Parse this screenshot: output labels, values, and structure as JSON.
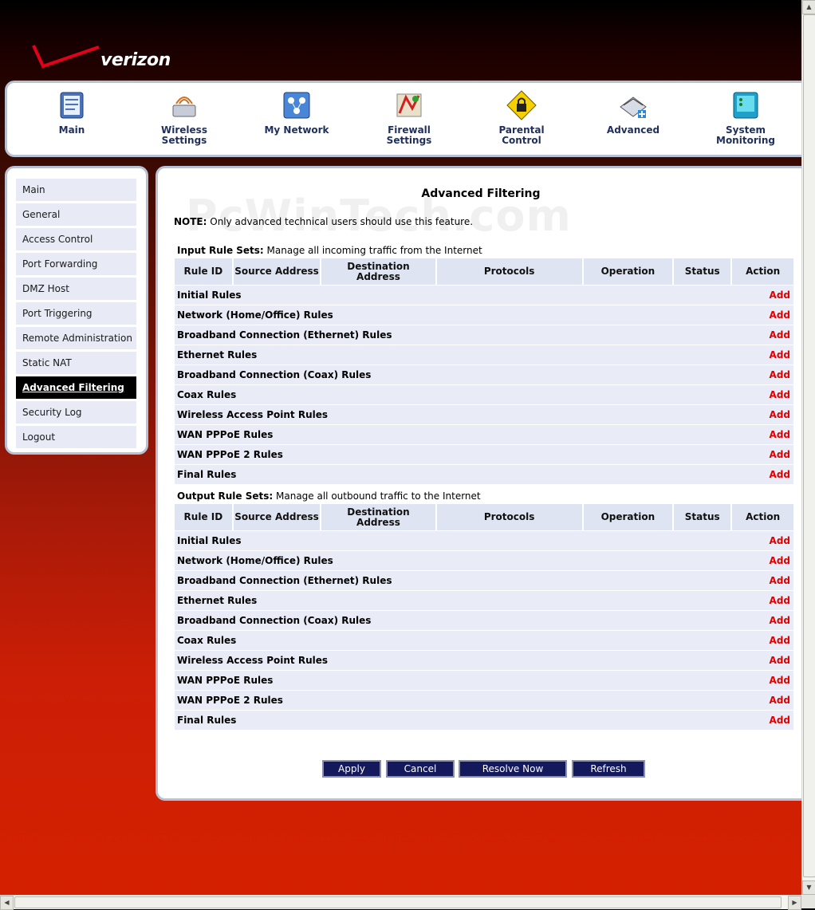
{
  "brand": {
    "name": "verizon"
  },
  "watermark": "PcWinTech.com",
  "nav": [
    {
      "label": "Main",
      "icon": "main-icon"
    },
    {
      "label": "Wireless\nSettings",
      "icon": "wireless-settings-icon"
    },
    {
      "label": "My Network",
      "icon": "my-network-icon"
    },
    {
      "label": "Firewall\nSettings",
      "icon": "firewall-settings-icon"
    },
    {
      "label": "Parental\nControl",
      "icon": "parental-control-icon"
    },
    {
      "label": "Advanced",
      "icon": "advanced-icon"
    },
    {
      "label": "System\nMonitoring",
      "icon": "system-monitoring-icon"
    }
  ],
  "menu": [
    {
      "label": "Main",
      "active": false
    },
    {
      "label": "General",
      "active": false
    },
    {
      "label": "Access Control",
      "active": false
    },
    {
      "label": "Port Forwarding",
      "active": false
    },
    {
      "label": "DMZ Host",
      "active": false
    },
    {
      "label": "Port Triggering",
      "active": false
    },
    {
      "label": "Remote Administration",
      "active": false
    },
    {
      "label": "Static NAT",
      "active": false
    },
    {
      "label": "Advanced Filtering",
      "active": true
    },
    {
      "label": "Security Log",
      "active": false
    },
    {
      "label": "Logout",
      "active": false
    }
  ],
  "page": {
    "title": "Advanced Filtering",
    "note_label": "NOTE:",
    "note_text": " Only advanced technical users should use this feature."
  },
  "columns": [
    "Rule ID",
    "Source Address",
    "Destination Address",
    "Protocols",
    "Operation",
    "Status",
    "Action"
  ],
  "input_set": {
    "label": "Input Rule Sets:",
    "desc": " Manage all incoming traffic from the Internet",
    "rows": [
      "Initial Rules",
      "Network (Home/Office) Rules",
      "Broadband Connection (Ethernet) Rules",
      "Ethernet Rules",
      "Broadband Connection (Coax) Rules",
      "Coax Rules",
      "Wireless Access Point Rules",
      "WAN PPPoE Rules",
      "WAN PPPoE 2 Rules",
      "Final Rules"
    ]
  },
  "output_set": {
    "label": "Output Rule Sets:",
    "desc": " Manage all outbound traffic to the Internet",
    "rows": [
      "Initial Rules",
      "Network (Home/Office) Rules",
      "Broadband Connection (Ethernet) Rules",
      "Ethernet Rules",
      "Broadband Connection (Coax) Rules",
      "Coax Rules",
      "Wireless Access Point Rules",
      "WAN PPPoE Rules",
      "WAN PPPoE 2 Rules",
      "Final Rules"
    ]
  },
  "add_label": "Add",
  "buttons": {
    "apply": "Apply",
    "cancel": "Cancel",
    "resolve": "Resolve Now",
    "refresh": "Refresh"
  },
  "colors": {
    "add": "#e00000",
    "button_bg": "#13195a",
    "active_menu": "#000000"
  }
}
